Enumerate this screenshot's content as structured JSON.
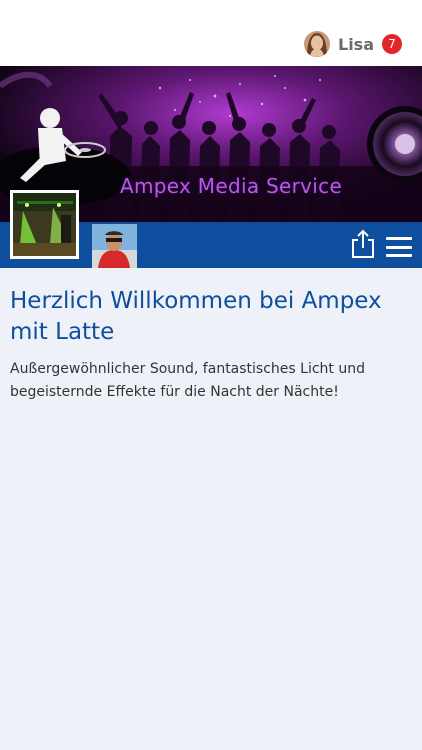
{
  "header": {
    "user_name": "Lisa",
    "notification_count": "7"
  },
  "banner": {
    "title": "Ampex Media Service"
  },
  "main": {
    "headline": "Herzlich Willkommen bei Ampex mit Latte",
    "intro": "Außergewöhnlicher Sound, fantastisches Licht und begeisternde Effekte für die Nacht der Nächte!"
  },
  "colors": {
    "brand_blue": "#0d4f9e",
    "badge_red": "#e3262c",
    "banner_purple": "#b659e8"
  },
  "icons": {
    "share": "share-icon",
    "menu": "hamburger-menu-icon"
  }
}
